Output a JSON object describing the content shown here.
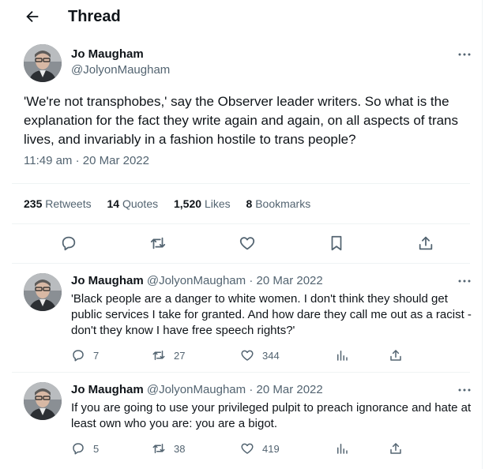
{
  "header": {
    "title": "Thread",
    "back_icon": "arrow-left-icon"
  },
  "main_tweet": {
    "author_name": "Jo Maugham",
    "author_handle": "@JolyonMaugham",
    "text": "'We're not transphobes,' say the Observer leader writers. So what is the explanation for the fact they write again and again, on all aspects of trans lives, and invariably in a fashion hostile to trans people?",
    "timestamp": "11:49 am · 20 Mar 2022",
    "stats": {
      "retweets_count": "235",
      "retweets_label": "Retweets",
      "quotes_count": "14",
      "quotes_label": "Quotes",
      "likes_count": "1,520",
      "likes_label": "Likes",
      "bookmarks_count": "8",
      "bookmarks_label": "Bookmarks"
    },
    "actions": [
      "reply-icon",
      "retweet-icon",
      "like-icon",
      "bookmark-icon",
      "share-icon"
    ]
  },
  "replies": [
    {
      "author_name": "Jo Maugham",
      "author_handle": "@JolyonMaugham",
      "dot": "·",
      "date": "20 Mar 2022",
      "text": "'Black people are a danger to white women. I don't think they should get public services I take for granted. And how dare they call me out as a racist - don't they know I have free speech rights?'",
      "replies": "7",
      "retweets": "27",
      "likes": "344"
    },
    {
      "author_name": "Jo Maugham",
      "author_handle": "@JolyonMaugham",
      "dot": "·",
      "date": "20 Mar 2022",
      "text": "If you are going to use your privileged pulpit to preach ignorance and hate at least own who you are: you are a bigot.",
      "replies": "5",
      "retweets": "38",
      "likes": "419"
    }
  ],
  "colors": {
    "text": "#0f1419",
    "secondary": "#536471",
    "divider": "#eff3f4"
  }
}
